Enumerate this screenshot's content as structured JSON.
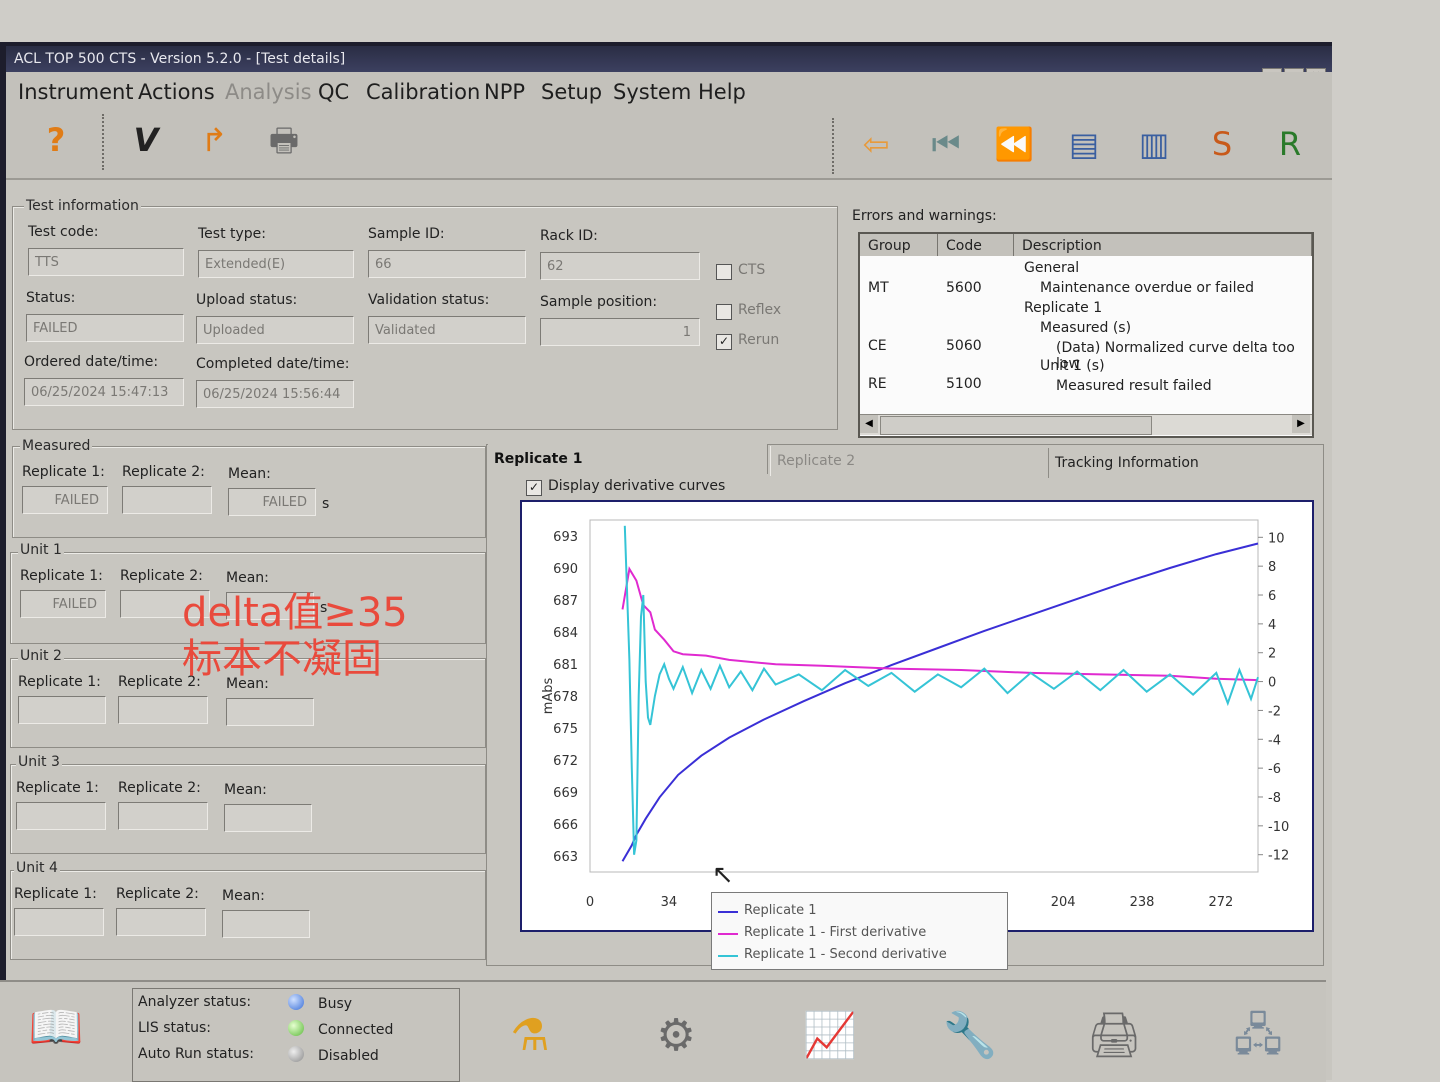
{
  "window": {
    "title": "ACL TOP 500 CTS - Version 5.2.0 - [Test details]"
  },
  "menu": [
    "Instrument",
    "Actions",
    "Analysis",
    "QC",
    "Calibration",
    "NPP",
    "Setup",
    "System",
    "Help"
  ],
  "test_info": {
    "group_label": "Test information",
    "test_code_label": "Test code:",
    "test_code": "TTS",
    "test_type_label": "Test type:",
    "test_type": "Extended(E)",
    "sample_id_label": "Sample ID:",
    "sample_id": "66",
    "rack_id_label": "Rack ID:",
    "rack_id": "62",
    "status_label": "Status:",
    "status": "FAILED",
    "upload_label": "Upload status:",
    "upload": "Uploaded",
    "validation_label": "Validation status:",
    "validation": "Validated",
    "sample_pos_label": "Sample position:",
    "sample_pos": "1",
    "ordered_label": "Ordered date/time:",
    "ordered": "06/25/2024 15:47:13",
    "completed_label": "Completed date/time:",
    "completed": "06/25/2024 15:56:44",
    "cts_label": "CTS",
    "reflex_label": "Reflex",
    "rerun_label": "Rerun"
  },
  "errors": {
    "title": "Errors and warnings:",
    "headers": [
      "Group",
      "Code",
      "Description"
    ],
    "rows": [
      {
        "group": "MT",
        "code": "5600"
      },
      {
        "group": "CE",
        "code": "5060"
      },
      {
        "group": "RE",
        "code": "5100"
      }
    ],
    "desc_lines": [
      "General",
      "Maintenance overdue or failed",
      "Replicate 1",
      "Measured (s)",
      "(Data) Normalized curve delta too low",
      "Unit 1 (s)",
      "Measured result failed"
    ]
  },
  "measured": {
    "group": "Measured",
    "rep1_label": "Replicate 1:",
    "rep1": "FAILED",
    "rep2_label": "Replicate 2:",
    "rep2": "",
    "mean_label": "Mean:",
    "mean": "FAILED",
    "unit": "s"
  },
  "units": [
    {
      "group": "Unit 1",
      "rep1": "FAILED",
      "rep2": "",
      "mean": "",
      "unit": "s"
    },
    {
      "group": "Unit 2",
      "rep1": "",
      "rep2": "",
      "mean": ""
    },
    {
      "group": "Unit 3",
      "rep1": "",
      "rep2": "",
      "mean": ""
    },
    {
      "group": "Unit 4",
      "rep1": "",
      "rep2": "",
      "mean": ""
    }
  ],
  "labels": {
    "rep1": "Replicate 1:",
    "rep2": "Replicate 2:",
    "mean": "Mean:"
  },
  "tabs": [
    "Replicate 1",
    "Replicate 2",
    "Tracking Information"
  ],
  "display_derivative": "Display derivative curves",
  "annotation": {
    "line1": "delta值≥35",
    "line2": "标本不凝固"
  },
  "chart_data": {
    "type": "line",
    "ylabel": "mAbs",
    "y_ticks": [
      693,
      690,
      687,
      684,
      681,
      678,
      675,
      672,
      669,
      666,
      663
    ],
    "y2_ticks": [
      10,
      8,
      6,
      4,
      2,
      0,
      -2,
      -4,
      -6,
      -8,
      -10,
      -12
    ],
    "x_ticks": [
      0,
      34,
      204,
      238,
      272
    ],
    "xlim": [
      0,
      288
    ],
    "ylim": [
      661.5,
      694.5
    ],
    "y2lim": [
      -13.2,
      11.2
    ],
    "series": [
      {
        "name": "Replicate 1",
        "color": "#3a2fd6",
        "axis": "left",
        "x": [
          14,
          18,
          20,
          24,
          30,
          38,
          48,
          60,
          75,
          92,
          110,
          130,
          150,
          170,
          190,
          210,
          230,
          250,
          270,
          288
        ],
        "y": [
          662.5,
          664.0,
          665.0,
          666.5,
          668.5,
          670.6,
          672.4,
          674.1,
          675.8,
          677.5,
          679.2,
          680.9,
          682.5,
          684.1,
          685.6,
          687.1,
          688.6,
          690.0,
          691.3,
          692.3
        ]
      },
      {
        "name": "Replicate 1 - First derivative",
        "color": "#e02ad0",
        "axis": "right",
        "x": [
          14,
          17,
          20,
          23,
          26,
          28,
          32,
          36,
          40,
          50,
          60,
          80,
          100,
          130,
          160,
          190,
          220,
          250,
          270,
          288
        ],
        "y": [
          5.0,
          7.8,
          7.0,
          5.3,
          4.8,
          3.6,
          2.9,
          2.1,
          1.9,
          1.8,
          1.5,
          1.2,
          1.1,
          0.9,
          0.8,
          0.6,
          0.5,
          0.4,
          0.2,
          0.1
        ]
      },
      {
        "name": "Replicate 1 - Second derivative",
        "color": "#35c4d6",
        "axis": "right",
        "x": [
          15,
          17,
          18,
          19,
          20,
          21,
          22,
          23,
          24,
          25,
          26,
          28,
          30,
          32,
          34,
          36,
          40,
          44,
          48,
          52,
          56,
          60,
          65,
          70,
          75,
          80,
          90,
          100,
          110,
          120,
          130,
          140,
          150,
          160,
          170,
          180,
          190,
          200,
          210,
          220,
          230,
          240,
          250,
          260,
          270,
          275,
          280,
          285,
          288
        ],
        "y": [
          10.8,
          1.5,
          -6.0,
          -12.0,
          -11.0,
          -1.0,
          4.5,
          6.0,
          0.0,
          -2.5,
          -3.0,
          -1.0,
          0.5,
          1.2,
          0.2,
          -0.5,
          1.0,
          -0.8,
          0.8,
          -0.5,
          1.1,
          -0.4,
          0.7,
          -0.6,
          0.9,
          -0.2,
          0.5,
          -0.6,
          0.8,
          -0.3,
          0.6,
          -0.7,
          0.5,
          -0.4,
          0.9,
          -0.8,
          0.6,
          -0.5,
          0.7,
          -0.6,
          0.8,
          -0.7,
          0.5,
          -0.9,
          0.6,
          -1.5,
          0.8,
          -1.2,
          0.3
        ]
      }
    ]
  },
  "status": {
    "analyzer_label": "Analyzer status:",
    "analyzer": "Busy",
    "lis_label": "LIS status:",
    "lis": "Connected",
    "autorun_label": "Auto Run status:",
    "autorun": "Disabled"
  }
}
